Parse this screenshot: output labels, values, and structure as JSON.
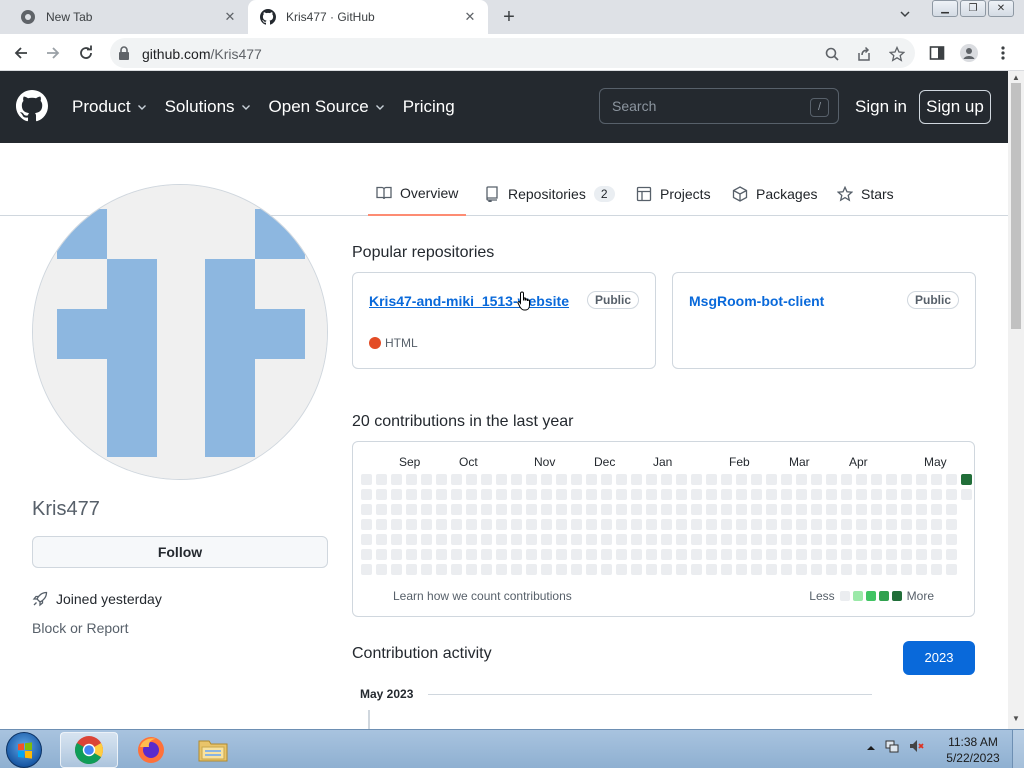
{
  "browser": {
    "tabs": [
      {
        "title": "New Tab",
        "active": false
      },
      {
        "title": "Kris477 · GitHub",
        "active": true
      }
    ],
    "url_host": "github.com",
    "url_path": "/Kris477"
  },
  "gh_header": {
    "nav": [
      "Product",
      "Solutions",
      "Open Source",
      "Pricing"
    ],
    "search_placeholder": "Search",
    "search_shortcut": "/",
    "signin": "Sign in",
    "signup": "Sign up"
  },
  "profile_tabs": [
    {
      "label": "Overview",
      "icon": "book-icon",
      "active": true
    },
    {
      "label": "Repositories",
      "icon": "repo-icon",
      "count": "2"
    },
    {
      "label": "Projects",
      "icon": "table-icon"
    },
    {
      "label": "Packages",
      "icon": "package-icon"
    },
    {
      "label": "Stars",
      "icon": "star-icon"
    }
  ],
  "profile": {
    "username": "Kris477",
    "follow": "Follow",
    "joined": "Joined yesterday",
    "block": "Block or Report"
  },
  "popular": {
    "title": "Popular repositories",
    "repos": [
      {
        "name": "Kris47-and-miki_1513-website",
        "visibility": "Public",
        "language": "HTML",
        "language_color": "#e34c26"
      },
      {
        "name": "MsgRoom-bot-client",
        "visibility": "Public",
        "language": "",
        "language_color": ""
      }
    ]
  },
  "contributions": {
    "title": "20 contributions in the last year",
    "months": [
      "Sep",
      "Oct",
      "Nov",
      "Dec",
      "Jan",
      "Feb",
      "Mar",
      "Apr",
      "May"
    ],
    "learn": "Learn how we count contributions",
    "less": "Less",
    "more": "More",
    "legend_colors": [
      "#ebedf0",
      "#9be9a8",
      "#40c463",
      "#30a14e",
      "#216e39"
    ]
  },
  "activity": {
    "title": "Contribution activity",
    "year": "2023",
    "month": "May 2023"
  },
  "taskbar": {
    "time": "11:38 AM",
    "date": "5/22/2023"
  }
}
